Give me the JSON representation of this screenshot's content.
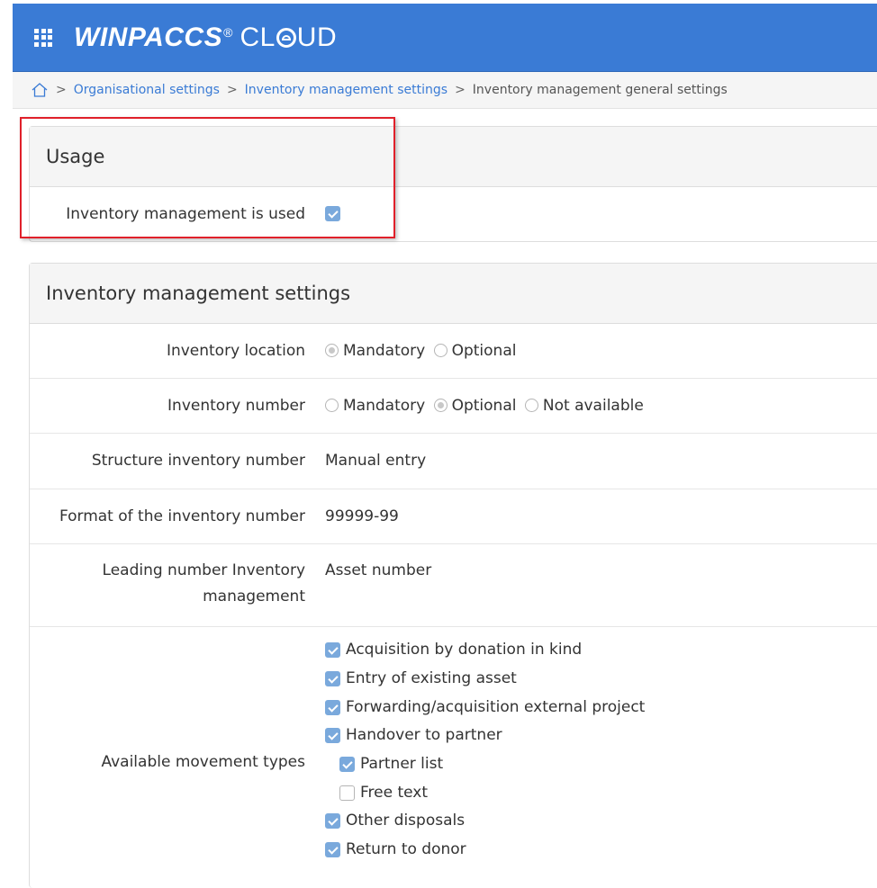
{
  "header": {
    "brand": "WINPACCS",
    "registered": "®",
    "cloud_prefix": "CL",
    "cloud_suffix": "UD",
    "brand_color": "#3a7bd5"
  },
  "breadcrumb": {
    "items": [
      "Organisational settings",
      "Inventory management settings"
    ],
    "current": "Inventory management general settings",
    "separator": ">"
  },
  "usage": {
    "title": "Usage",
    "is_used_label": "Inventory management is used",
    "is_used_checked": true
  },
  "settings": {
    "title": "Inventory management settings",
    "location_label": "Inventory location",
    "location_options": [
      "Mandatory",
      "Optional"
    ],
    "location_selected": "Mandatory",
    "number_label": "Inventory number",
    "number_options": [
      "Mandatory",
      "Optional",
      "Not available"
    ],
    "number_selected": "Optional",
    "structure_label": "Structure inventory number",
    "structure_value": "Manual entry",
    "format_label": "Format of the inventory number",
    "format_value": "99999-99",
    "leading_label": "Leading number Inventory management",
    "leading_value": "Asset number",
    "movements_label": "Available movement types",
    "movements": [
      {
        "label": "Acquisition by donation in kind",
        "checked": true
      },
      {
        "label": "Entry of existing asset",
        "checked": true
      },
      {
        "label": "Forwarding/acquisition external project",
        "checked": true
      },
      {
        "label": "Handover to partner",
        "checked": true
      },
      {
        "label": "Partner list",
        "checked": true,
        "sub": true
      },
      {
        "label": "Free text",
        "checked": false,
        "sub": true
      },
      {
        "label": "Other disposals",
        "checked": true
      },
      {
        "label": "Return to donor",
        "checked": true
      }
    ]
  }
}
